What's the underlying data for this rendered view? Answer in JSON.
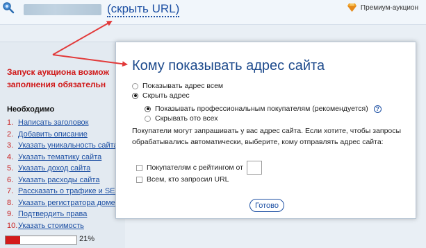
{
  "header": {
    "hide_url_link": "(скрыть URL)",
    "premium_label": "Премиум-аукцион"
  },
  "left_panel": {
    "launch_notice_line1": "Запуск аукциона возмож",
    "launch_notice_line2": "заполнения обязательн",
    "required_title": "Необходимо",
    "steps": [
      {
        "num": "1.",
        "label": "Написать заголовок"
      },
      {
        "num": "2.",
        "label": "Добавить описание"
      },
      {
        "num": "3.",
        "label": "Указать уникальность сайта"
      },
      {
        "num": "4.",
        "label": "Указать тематику сайта"
      },
      {
        "num": "5.",
        "label": "Указать доход сайта"
      },
      {
        "num": "6.",
        "label": "Указать расходы сайта"
      },
      {
        "num": "7.",
        "label": "Рассказать о трафике и SEO"
      },
      {
        "num": "8.",
        "label": "Указать регистратора домена"
      },
      {
        "num": "9.",
        "label": "Подтвердить права"
      },
      {
        "num": "10.",
        "label": "Указать стоимость"
      }
    ],
    "progress_label": "21%",
    "progress_value": 21
  },
  "modal": {
    "title": "Кому показывать адрес сайта",
    "options": {
      "show_all": "Показывать адрес всем",
      "hide": "Скрыть адрес",
      "show_pro": "Показывать профессиональным покупателям (рекомендуется)",
      "hide_all": "Скрывать ото всех"
    },
    "info_text": "Покупатели могут запрашивать у вас адрес сайта. Если хотите, чтобы запросы обрабатывались автоматически, выберите, кому отправлять адрес сайта:",
    "checkbox_rating": "Покупателям с рейтингом от",
    "checkbox_requested": "Всем, кто запросил URL",
    "rating_value": "",
    "done_button": "Готово",
    "help_symbol": "?"
  },
  "colors": {
    "link": "#1c4fa3",
    "title": "#1d4a8c",
    "alert": "#d01818",
    "arrow": "#e23a3a",
    "progress": "#d31a1a"
  },
  "icons": {
    "logo": "magnifier-globe-icon",
    "premium": "diamond-icon",
    "help": "question-circle-icon"
  }
}
